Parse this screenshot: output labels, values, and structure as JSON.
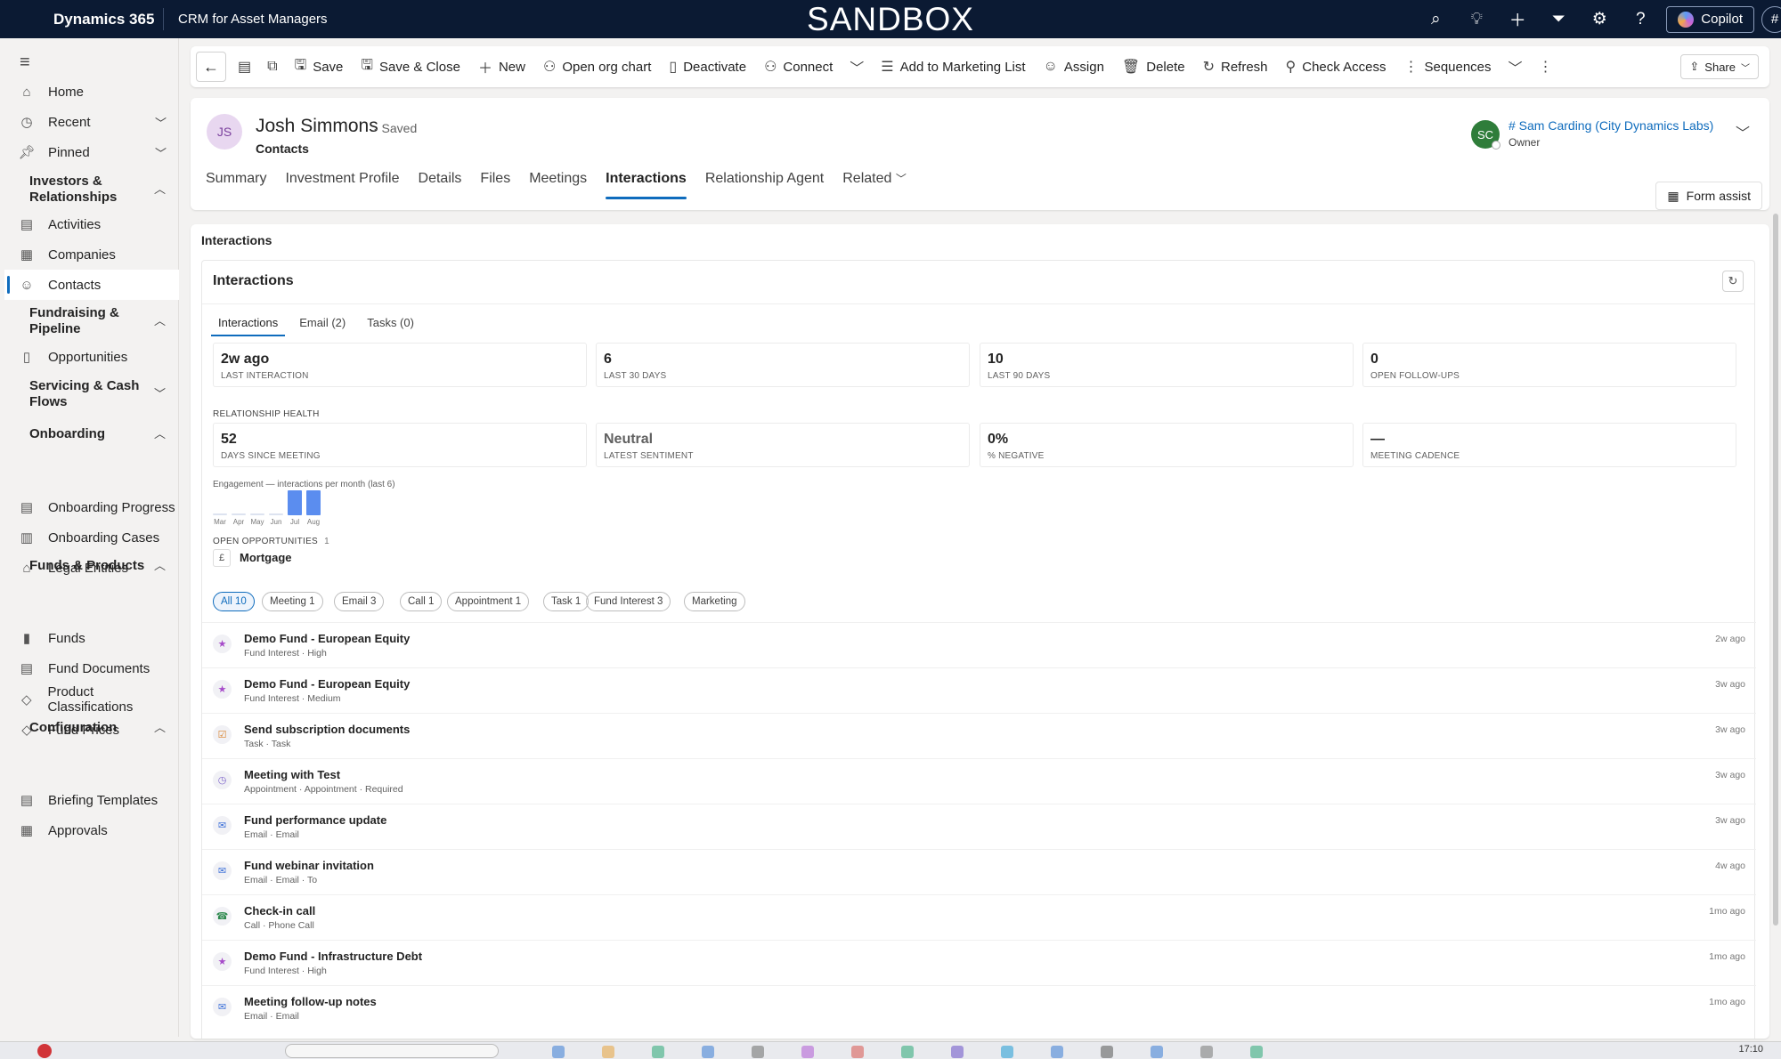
{
  "topbar": {
    "brand": "Dynamics 365",
    "app_name": "CRM for Asset Managers",
    "environment": "SANDBOX",
    "copilot_label": "Copilot",
    "hash_label": "#"
  },
  "sidebar": {
    "items": {
      "home": "Home",
      "recent": "Recent",
      "pinned": "Pinned",
      "activities": "Activities",
      "companies": "Companies",
      "contacts": "Contacts",
      "opportunities": "Opportunities",
      "onboarding_progress": "Onboarding Progress",
      "onboarding_cases": "Onboarding Cases",
      "legal_entities": "Legal Entities",
      "funds": "Funds",
      "fund_documents": "Fund Documents",
      "product_classifications": "Product Classifications",
      "fund_prices": "Fund Prices",
      "briefing_templates": "Briefing Templates",
      "approvals": "Approvals"
    },
    "groups": {
      "investors": "Investors & Relationships",
      "fundraising": "Fundraising & Pipeline",
      "servicing": "Servicing & Cash Flows",
      "onboarding": "Onboarding",
      "funds_products": "Funds & Products",
      "configuration": "Configuration"
    }
  },
  "commands": {
    "save": "Save",
    "save_close": "Save & Close",
    "new": "New",
    "open_org_chart": "Open org chart",
    "deactivate": "Deactivate",
    "connect": "Connect",
    "add_marketing": "Add to Marketing List",
    "assign": "Assign",
    "delete": "Delete",
    "refresh": "Refresh",
    "check_access": "Check Access",
    "sequences": "Sequences",
    "share": "Share"
  },
  "record": {
    "initials": "JS",
    "name": "Josh Simmons",
    "saved": "- Saved",
    "entity": "Contacts",
    "owner_initials": "SC",
    "owner_name": "# Sam Carding (City Dynamics Labs)",
    "owner_role": "Owner",
    "form_assist": "Form assist",
    "tabs": [
      "Summary",
      "Investment Profile",
      "Details",
      "Files",
      "Meetings",
      "Interactions",
      "Relationship Agent",
      "Related"
    ]
  },
  "interactions": {
    "section_title": "Interactions",
    "card_title": "Interactions",
    "subtabs": [
      "Interactions",
      "Email (2)",
      "Tasks (0)"
    ],
    "stats": [
      {
        "value": "2w ago",
        "label": "LAST INTERACTION"
      },
      {
        "value": "6",
        "label": "LAST 30 DAYS"
      },
      {
        "value": "10",
        "label": "LAST 90 DAYS"
      },
      {
        "value": "0",
        "label": "OPEN FOLLOW-UPS"
      }
    ],
    "health_title": "RELATIONSHIP HEALTH",
    "health": [
      {
        "value": "52",
        "label": "DAYS SINCE MEETING"
      },
      {
        "value": "Neutral",
        "label": "LATEST SENTIMENT"
      },
      {
        "value": "0%",
        "label": "% NEGATIVE"
      },
      {
        "value": "—",
        "label": "MEETING CADENCE"
      }
    ],
    "engagement_caption": "Engagement — interactions per month (last 6)",
    "engagement": {
      "months": [
        "Mar",
        "Apr",
        "May",
        "Jun",
        "Jul",
        "Aug"
      ],
      "values": [
        0,
        0,
        0,
        0,
        5,
        5
      ]
    },
    "open_opps_title": "OPEN OPPORTUNITIES",
    "open_opps_count": "1",
    "opportunity": {
      "icon": "£",
      "name": "Mortgage"
    },
    "filters": [
      "All 10",
      "Meeting 1",
      "Email 3",
      "Call 1",
      "Appointment 1",
      "Task 1",
      "Fund Interest 3",
      "Marketing"
    ],
    "rows": [
      {
        "icon": "star-icon",
        "glyph": "★",
        "color": "#a64ac9",
        "title": "Demo Fund - European Equity",
        "sub": "Fund Interest · High",
        "time": "2w ago"
      },
      {
        "icon": "star-icon",
        "glyph": "★",
        "color": "#a64ac9",
        "title": "Demo Fund - European Equity",
        "sub": "Fund Interest · Medium",
        "time": "3w ago"
      },
      {
        "icon": "task-icon",
        "glyph": "☑",
        "color": "#d9822b",
        "title": "Send subscription documents",
        "sub": "Task · Task",
        "time": "3w ago"
      },
      {
        "icon": "clock-icon",
        "glyph": "◷",
        "color": "#7b61c9",
        "title": "Meeting with Test",
        "sub": "Appointment · Appointment · Required",
        "time": "3w ago"
      },
      {
        "icon": "mail-icon",
        "glyph": "✉",
        "color": "#3b6fd8",
        "title": "Fund performance update",
        "sub": "Email · Email",
        "time": "3w ago"
      },
      {
        "icon": "mail-icon",
        "glyph": "✉",
        "color": "#3b6fd8",
        "title": "Fund webinar invitation",
        "sub": "Email · Email · To",
        "time": "4w ago"
      },
      {
        "icon": "phone-icon",
        "glyph": "☎",
        "color": "#2f8a4f",
        "title": "Check-in call",
        "sub": "Call · Phone Call",
        "time": "1mo ago"
      },
      {
        "icon": "star-icon",
        "glyph": "★",
        "color": "#a64ac9",
        "title": "Demo Fund - Infrastructure Debt",
        "sub": "Fund Interest · High",
        "time": "1mo ago"
      },
      {
        "icon": "mail-icon",
        "glyph": "✉",
        "color": "#3b6fd8",
        "title": "Meeting follow-up notes",
        "sub": "Email · Email",
        "time": "1mo ago"
      }
    ]
  },
  "taskbar": {
    "time": "17:10"
  }
}
